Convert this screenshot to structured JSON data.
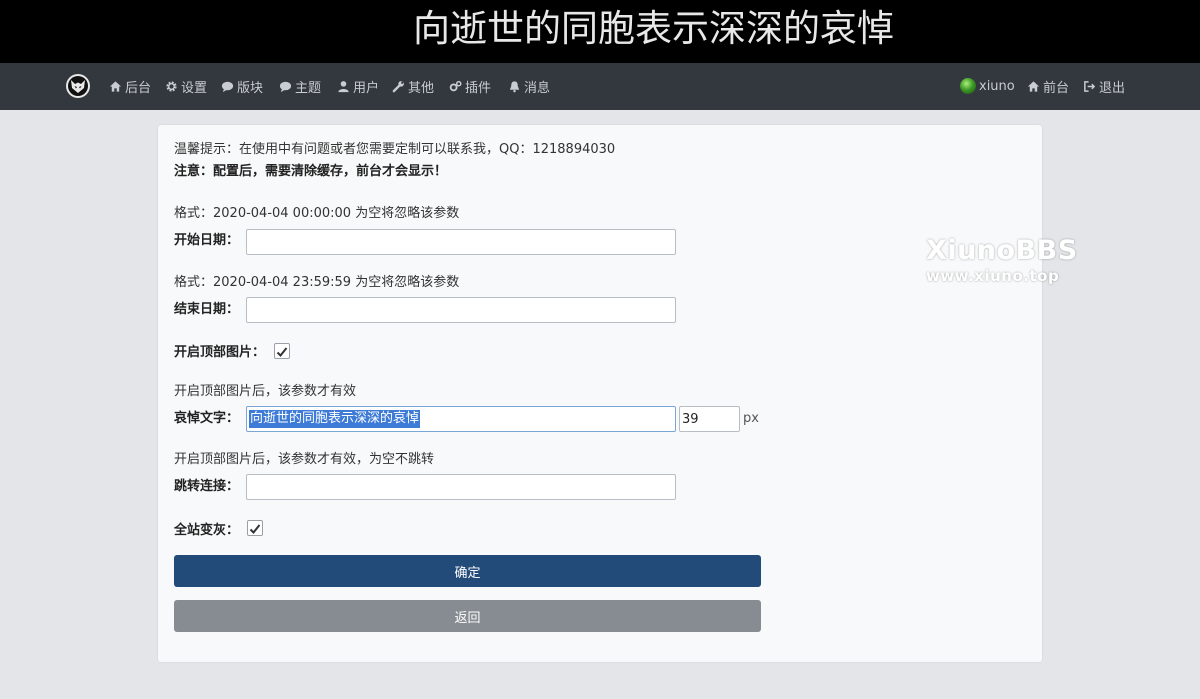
{
  "banner": {
    "text": "向逝世的同胞表示深深的哀悼"
  },
  "navbar": {
    "items": [
      {
        "label": "后台",
        "icon": "home-icon"
      },
      {
        "label": "设置",
        "icon": "gear-icon"
      },
      {
        "label": "版块",
        "icon": "comment-icon"
      },
      {
        "label": "主题",
        "icon": "comments-icon"
      },
      {
        "label": "用户",
        "icon": "user-icon"
      },
      {
        "label": "其他",
        "icon": "wrench-icon"
      },
      {
        "label": "插件",
        "icon": "gears-icon"
      },
      {
        "label": "消息",
        "icon": "bell-icon"
      }
    ],
    "right": {
      "username": "xiuno",
      "frontend": "前台",
      "logout": "退出"
    }
  },
  "form": {
    "tip": "温馨提示：在使用中有问题或者您需要定制可以联系我，QQ：1218894030",
    "notice": "注意：配置后，需要清除缓存，前台才会显示！",
    "start_hint": "格式：2020-04-04 00:00:00 为空将忽略该参数",
    "start_label": "开始日期：",
    "start_value": "",
    "end_hint": "格式：2020-04-04 23:59:59 为空将忽略该参数",
    "end_label": "结束日期：",
    "end_value": "",
    "top_image_label": "开启顶部图片：",
    "top_image_checked": true,
    "mourning_hint": "开启顶部图片后，该参数才有效",
    "mourning_label": "哀悼文字：",
    "mourning_value": "向逝世的同胞表示深深的哀悼",
    "font_size_value": "39",
    "font_size_unit": "px",
    "link_hint": "开启顶部图片后，该参数才有效，为空不跳转",
    "link_label": "跳转连接：",
    "link_value": "",
    "gray_label": "全站变灰：",
    "gray_checked": true,
    "submit_label": "确定",
    "back_label": "返回"
  },
  "watermark": {
    "brand": "XiunoBBS",
    "url": "www.xiuno.top"
  },
  "colors": {
    "banner_bg": "#000000",
    "navbar_bg": "#33373e",
    "primary_button": "#234b7a",
    "back_button": "#868c92",
    "selection": "#3d7bd6"
  }
}
